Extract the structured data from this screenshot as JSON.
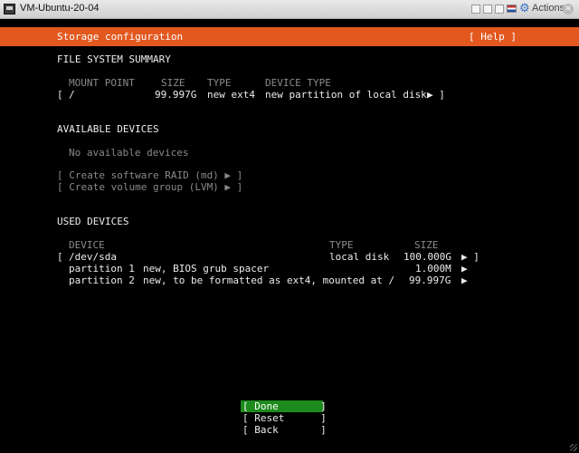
{
  "window": {
    "title": "VM-Ubuntu-20-04",
    "actions_label": "Actions"
  },
  "header": {
    "title": "Storage configuration",
    "help": "[ Help ]",
    "bg_color": "#e2581f"
  },
  "fs_summary": {
    "heading": "FILE SYSTEM SUMMARY",
    "columns": [
      "MOUNT POINT",
      "SIZE",
      "TYPE",
      "DEVICE TYPE"
    ],
    "row": {
      "bracket": "[",
      "mount": "/",
      "size": "99.997G",
      "type": "new ext4",
      "device_type": "new partition of local disk",
      "action": "▶ ]"
    }
  },
  "available": {
    "heading": "AVAILABLE DEVICES",
    "empty": "No available devices",
    "create_raid": "[ Create software RAID (md) ▶ ]",
    "create_lvm": "[ Create volume group (LVM) ▶ ]"
  },
  "used": {
    "heading": "USED DEVICES",
    "columns": [
      "DEVICE",
      "TYPE",
      "SIZE"
    ],
    "disk": {
      "bracket": "[",
      "name": "/dev/sda",
      "type": "local disk",
      "size": "100.000G",
      "action": "▶ ]"
    },
    "partitions": [
      {
        "name": "partition 1",
        "desc": "new, BIOS grub spacer",
        "size": "1.000M",
        "action": "▶"
      },
      {
        "name": "partition 2",
        "desc": "new, to be formatted as ext4, mounted at /",
        "size": "99.997G",
        "action": "▶"
      }
    ]
  },
  "buttons": {
    "done": "[ Done       ]",
    "reset": "[ Reset      ]",
    "back": "[ Back       ]",
    "done_color": "#1d8a1d"
  }
}
